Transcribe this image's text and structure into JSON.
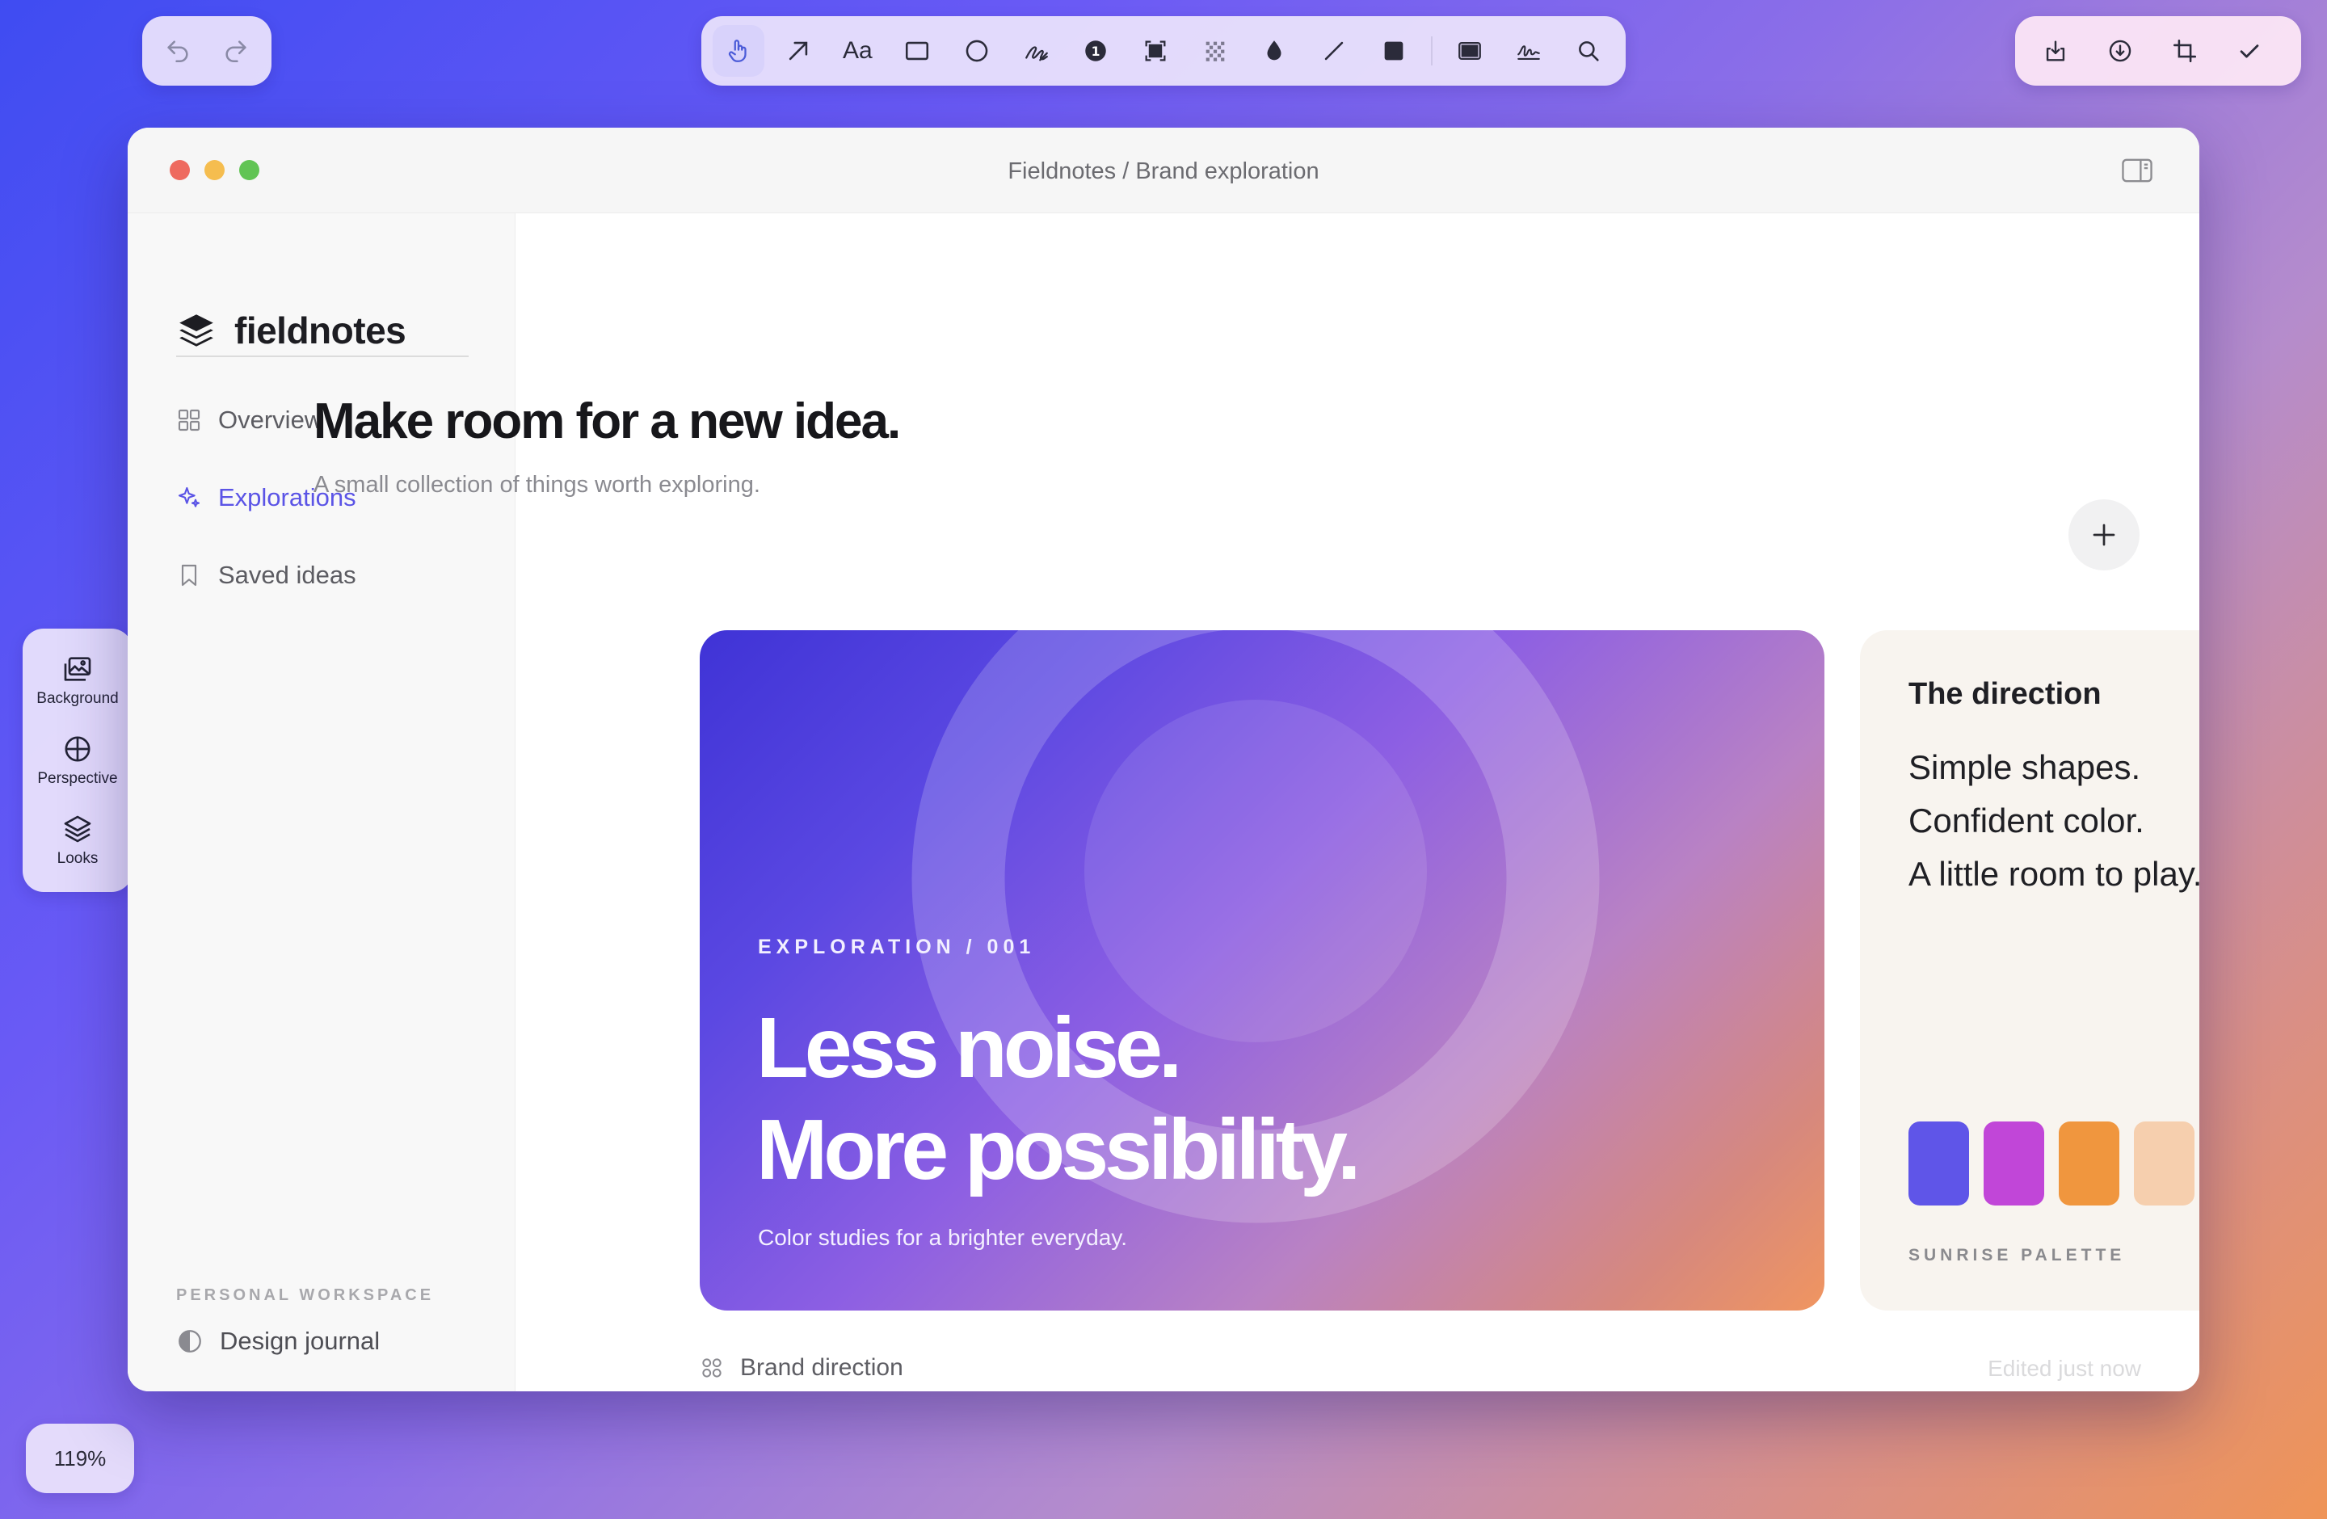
{
  "toolbar": {
    "undo_icon": "undo-icon",
    "redo_icon": "redo-icon",
    "text_tool_label": "Aa",
    "counter_label": "1",
    "tools": [
      "hand-pointer-icon",
      "arrow-icon",
      "text-icon",
      "rectangle-icon",
      "circle-icon",
      "freehand-icon",
      "counter-icon",
      "highlight-icon",
      "pixelate-icon",
      "blur-drop-icon",
      "line-icon",
      "filled-rectangle-icon",
      "window-icon",
      "signature-icon",
      "magnifier-icon"
    ],
    "actions": [
      "save-to-file-icon",
      "download-icon",
      "crop-icon",
      "checkmark-icon"
    ]
  },
  "side_panel": {
    "background_label": "Background",
    "perspective_label": "Perspective",
    "looks_label": "Looks"
  },
  "zoom": {
    "label": "119%"
  },
  "window": {
    "title": "Fieldnotes / Brand exploration"
  },
  "sidebar": {
    "brand": "fieldnotes",
    "items": [
      {
        "label": "Overview",
        "icon": "grid-icon",
        "active": false
      },
      {
        "label": "Explorations",
        "icon": "sparkle-icon",
        "active": true
      },
      {
        "label": "Saved ideas",
        "icon": "bookmark-icon",
        "active": false
      }
    ],
    "workspace_label": "PERSONAL WORKSPACE",
    "workspace_item": "Design journal"
  },
  "main": {
    "headline": "Make room for a new idea.",
    "subhead": "A small collection of things worth exploring.",
    "hero": {
      "eyebrow": "EXPLORATION  /  001",
      "line1": "Less noise.",
      "line2": "More possibility.",
      "caption": "Color studies for a brighter everyday."
    },
    "direction": {
      "title": "The direction",
      "lines": [
        "Simple shapes.",
        "Confident color.",
        "A little room to play."
      ],
      "swatches": [
        "#5f55e8",
        "#c146d8",
        "#f0963e",
        "#f6cfae"
      ],
      "palette_label": "SUNRISE PALETTE"
    },
    "footer": {
      "left": "Brand direction",
      "right": "Edited just now"
    }
  },
  "colors": {
    "accent": "#5b54e6",
    "traffic_red": "#ee6a5f",
    "traffic_yellow": "#f5bd4f",
    "traffic_green": "#61c454"
  }
}
